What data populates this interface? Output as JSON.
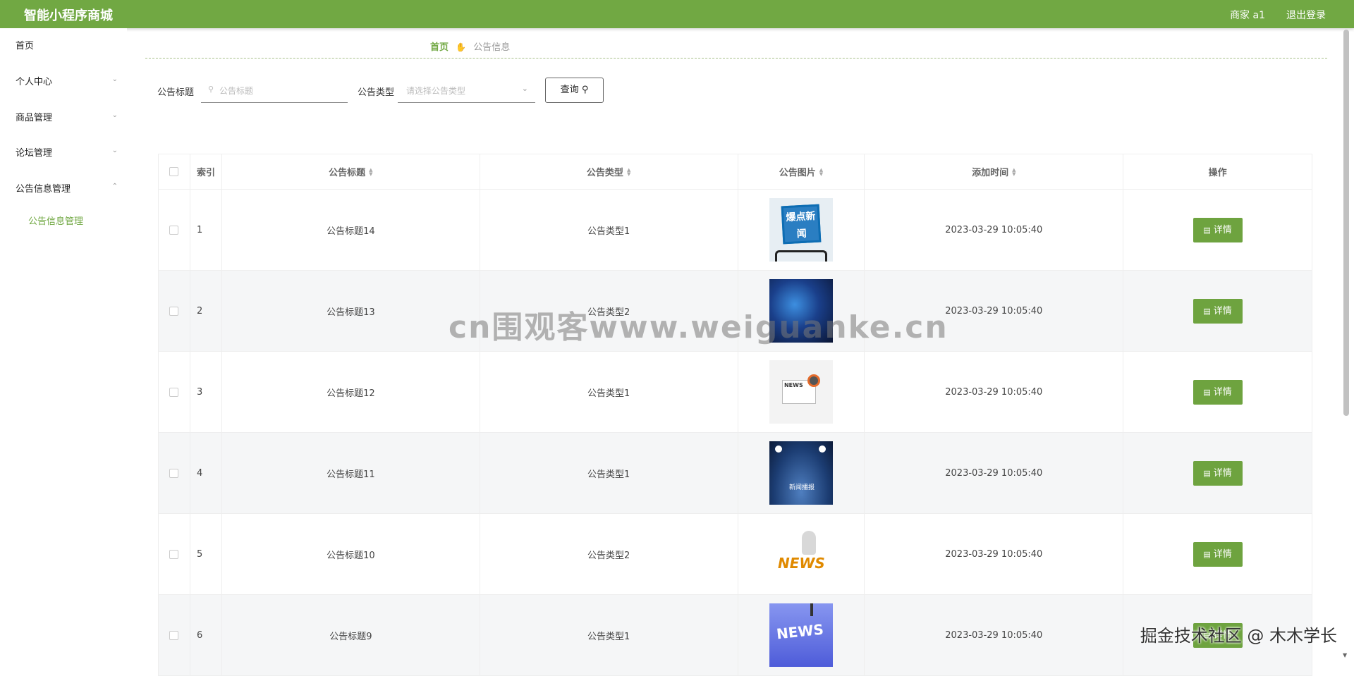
{
  "header": {
    "app_title": "智能小程序商城",
    "user": "商家 a1",
    "logout": "退出登录"
  },
  "sidebar": {
    "items": [
      {
        "label": "首页"
      },
      {
        "label": "个人中心"
      },
      {
        "label": "商品管理"
      },
      {
        "label": "论坛管理"
      },
      {
        "label": "公告信息管理"
      }
    ],
    "sub_item": "公告信息管理"
  },
  "breadcrumb": {
    "home": "首页",
    "separator_icon": "hand-icon",
    "current": "公告信息"
  },
  "search": {
    "title_label": "公告标题",
    "title_placeholder": "公告标题",
    "type_label": "公告类型",
    "type_placeholder": "请选择公告类型",
    "query_button": "查询"
  },
  "table": {
    "columns": [
      "索引",
      "公告标题",
      "公告类型",
      "公告图片",
      "添加时间",
      "操作"
    ],
    "rows": [
      {
        "index": "1",
        "title": "公告标题14",
        "type": "公告类型1",
        "image": "爆点新闻",
        "time": "2023-03-29 10:05:40",
        "action": "详情"
      },
      {
        "index": "2",
        "title": "公告标题13",
        "type": "公告类型2",
        "image": "globe",
        "time": "2023-03-29 10:05:40",
        "action": "详情"
      },
      {
        "index": "3",
        "title": "公告标题12",
        "type": "公告类型1",
        "image": "NEWS",
        "time": "2023-03-29 10:05:40",
        "action": "详情"
      },
      {
        "index": "4",
        "title": "公告标题11",
        "type": "公告类型1",
        "image": "新闻播报",
        "time": "2023-03-29 10:05:40",
        "action": "详情"
      },
      {
        "index": "5",
        "title": "公告标题10",
        "type": "公告类型2",
        "image": "NEWS",
        "time": "2023-03-29 10:05:40",
        "action": "详情"
      },
      {
        "index": "6",
        "title": "公告标题9",
        "type": "公告类型1",
        "image": "NEWS",
        "time": "2023-03-29 10:05:40",
        "action": "详情"
      }
    ]
  },
  "watermarks": {
    "center": "cn围观客www.weiguanke.cn",
    "corner": "掘金技术社区 @ 木木学长"
  },
  "colors": {
    "brand": "#71a843",
    "button": "#6ea33f"
  }
}
